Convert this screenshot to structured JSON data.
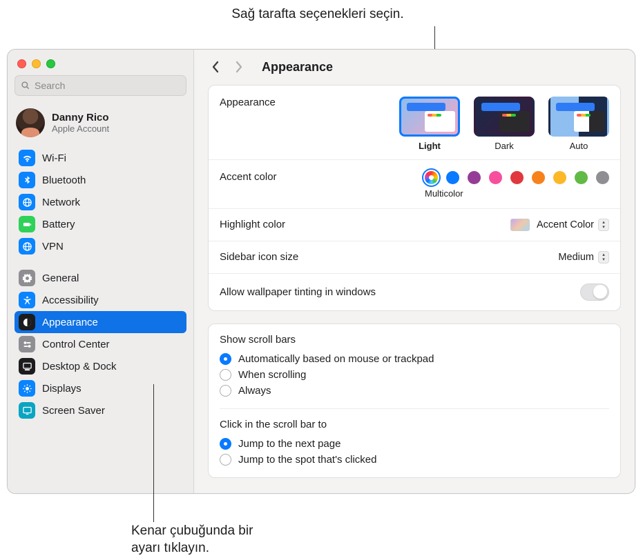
{
  "callouts": {
    "top": "Sağ tarafta seçenekleri seçin.",
    "bottom": "Kenar çubuğunda bir\nayarı tıklayın."
  },
  "search": {
    "placeholder": "Search"
  },
  "account": {
    "name": "Danny Rico",
    "subtitle": "Apple Account"
  },
  "sidebar": {
    "items": [
      {
        "id": "wifi",
        "label": "Wi-Fi",
        "icon": "wifi",
        "bg": "ic-blue"
      },
      {
        "id": "bluetooth",
        "label": "Bluetooth",
        "icon": "bluetooth",
        "bg": "ic-blue"
      },
      {
        "id": "network",
        "label": "Network",
        "icon": "network",
        "bg": "ic-blue"
      },
      {
        "id": "battery",
        "label": "Battery",
        "icon": "battery",
        "bg": "ic-green"
      },
      {
        "id": "vpn",
        "label": "VPN",
        "icon": "vpn",
        "bg": "ic-blue"
      }
    ],
    "items2": [
      {
        "id": "general",
        "label": "General",
        "icon": "gear",
        "bg": "ic-gray"
      },
      {
        "id": "accessibility",
        "label": "Accessibility",
        "icon": "accessibility",
        "bg": "ic-blue"
      },
      {
        "id": "appearance",
        "label": "Appearance",
        "icon": "appearance",
        "bg": "ic-black",
        "selected": true
      },
      {
        "id": "controlcenter",
        "label": "Control Center",
        "icon": "switches",
        "bg": "ic-gray"
      },
      {
        "id": "desktopdock",
        "label": "Desktop & Dock",
        "icon": "dock",
        "bg": "ic-black"
      },
      {
        "id": "displays",
        "label": "Displays",
        "icon": "display",
        "bg": "ic-blue"
      },
      {
        "id": "screensaver",
        "label": "Screen Saver",
        "icon": "screensaver",
        "bg": "ic-teal"
      }
    ]
  },
  "header": {
    "title": "Appearance"
  },
  "appearance": {
    "row_label": "Appearance",
    "modes": [
      {
        "id": "light",
        "label": "Light",
        "selected": true
      },
      {
        "id": "dark",
        "label": "Dark"
      },
      {
        "id": "auto",
        "label": "Auto"
      }
    ],
    "accent": {
      "row_label": "Accent color",
      "selected_label": "Multicolor",
      "swatches": [
        "multi",
        "blue",
        "purple",
        "pink",
        "red",
        "orange",
        "yellow",
        "green",
        "gray"
      ],
      "selected": "multi"
    },
    "highlight": {
      "row_label": "Highlight color",
      "value": "Accent Color"
    },
    "sidebar_size": {
      "row_label": "Sidebar icon size",
      "value": "Medium"
    },
    "tinting": {
      "label": "Allow wallpaper tinting in windows"
    },
    "scrollbars": {
      "title": "Show scroll bars",
      "options": [
        {
          "label": "Automatically based on mouse or trackpad",
          "checked": true
        },
        {
          "label": "When scrolling"
        },
        {
          "label": "Always"
        }
      ]
    },
    "click_scroll": {
      "title": "Click in the scroll bar to",
      "options": [
        {
          "label": "Jump to the next page",
          "checked": true
        },
        {
          "label": "Jump to the spot that's clicked"
        }
      ]
    }
  }
}
